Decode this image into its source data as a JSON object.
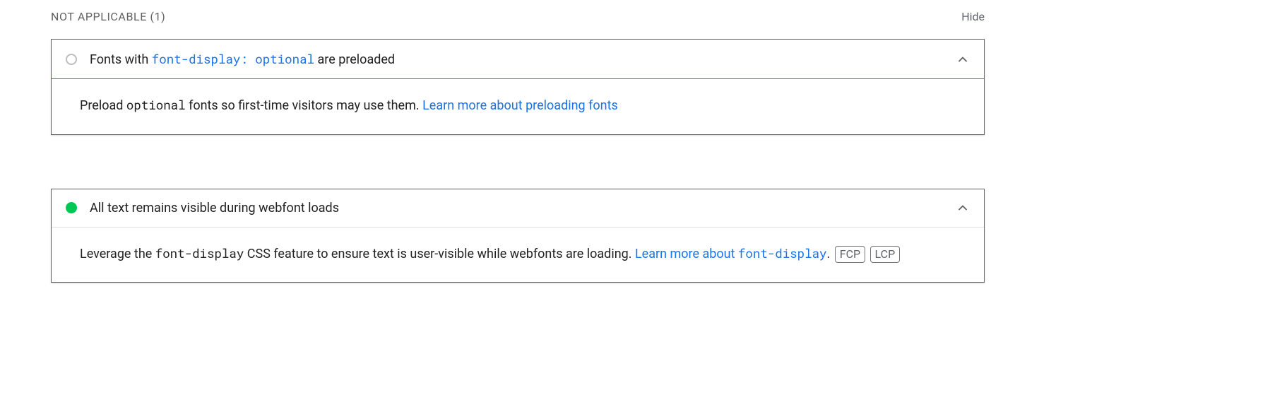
{
  "section": {
    "title": "NOT APPLICABLE (1)",
    "hide": "Hide"
  },
  "audit1": {
    "title_prefix": "Fonts with ",
    "title_code": "font-display: optional",
    "title_suffix": " are preloaded",
    "body_prefix": "Preload ",
    "body_code": "optional",
    "body_mid": " fonts so first-time visitors may use them. ",
    "body_link": "Learn more about preloading fonts"
  },
  "audit2": {
    "title": "All text remains visible during webfont loads",
    "body_prefix": "Leverage the ",
    "body_code1": "font-display",
    "body_mid": " CSS feature to ensure text is user-visible while webfonts are loading. ",
    "body_link_prefix": "Learn more about ",
    "body_link_code": "font-display",
    "body_period": ". ",
    "badge1": "FCP",
    "badge2": "LCP"
  }
}
